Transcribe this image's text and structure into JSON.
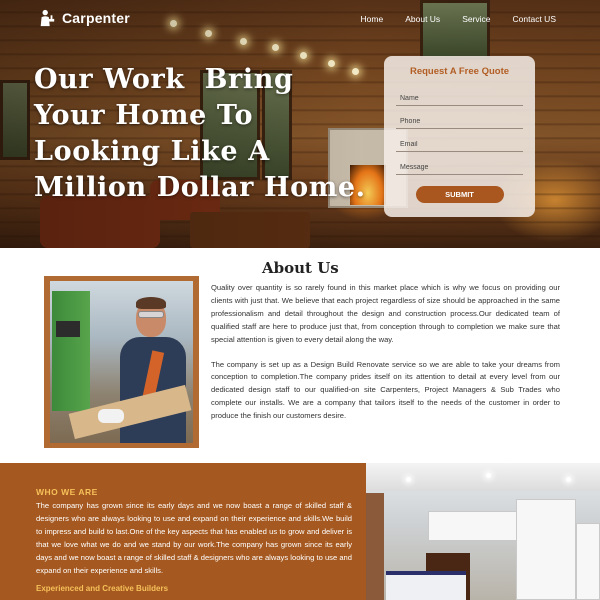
{
  "brand": {
    "name": "Carpenter"
  },
  "nav": {
    "items": [
      "Home",
      "About Us",
      "Service",
      "Contact US"
    ]
  },
  "hero": {
    "headline": "Our Work  Bring Your Home To Looking Like A Million Dollar Home."
  },
  "quote_form": {
    "title": "Request A Free Quote",
    "name_placeholder": "Name",
    "phone_placeholder": "Phone",
    "email_placeholder": "Email",
    "message_placeholder": "Message",
    "submit_label": "SUBMIT"
  },
  "about": {
    "title": "About Us",
    "paragraph_1": "Quality over quantity is so rarely found in this market place which is why we focus on providing our clients with just that. We believe that each project regardless of size should be approached in the same professionalism and detail throughout the design and construction process.Our dedicated team of qualified staff are here to produce just that, from conception through to completion we make sure that special attention is given to every detail along the way.",
    "paragraph_2": "The company is set up as a Design Build Renovate service so we are able to take your dreams from conception to completion.The company prides itself on its attention to detail at every level from our dedicated design staff to our qualified-on site Carpenters, Project Managers & Sub Trades who complete our installs. We are a company that tailors itself to the needs of the customer in order to produce the finish our customers desire."
  },
  "who": {
    "title": "WHO WE ARE",
    "text": "The company has grown since its early days and we now boast a range of skilled staff & designers who are always looking to use and expand on their experience and skills.We build to impress and build to last.One of the key aspects that has enabled us to grow and deliver is that we love what we do and we stand by our work.The company has grown since its early days and we now boast a range of skilled staff & designers who are always looking to use and expand on their experience and skills.",
    "subtitle": "Experienced and Creative Builders"
  },
  "colors": {
    "accent": "#a5581f",
    "accent_light": "#f6c15a",
    "quote_title": "#b25e24"
  },
  "icons": {
    "logo": "carpenter-logo-icon"
  }
}
